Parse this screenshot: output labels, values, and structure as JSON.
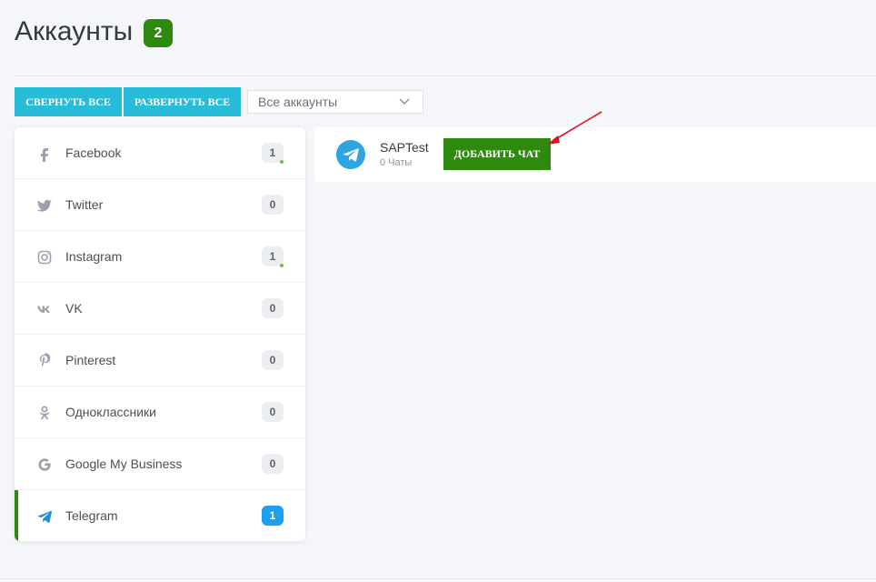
{
  "header": {
    "title": "Аккаунты",
    "count": "2"
  },
  "toolbar": {
    "collapse_all_label": "СВЕРНУТЬ ВСЕ",
    "expand_all_label": "РАЗВЕРНУТЬ ВСЕ",
    "filter_value": "Все аккаунты"
  },
  "sidebar": {
    "items": [
      {
        "label": "Facebook",
        "count": "1",
        "icon": "facebook-icon",
        "online": true
      },
      {
        "label": "Twitter",
        "count": "0",
        "icon": "twitter-icon"
      },
      {
        "label": "Instagram",
        "count": "1",
        "icon": "instagram-icon",
        "online": true
      },
      {
        "label": "VK",
        "count": "0",
        "icon": "vk-icon"
      },
      {
        "label": "Pinterest",
        "count": "0",
        "icon": "pinterest-icon"
      },
      {
        "label": "Одноклассники",
        "count": "0",
        "icon": "odnoklassniki-icon"
      },
      {
        "label": "Google My Business",
        "count": "0",
        "icon": "google-icon"
      },
      {
        "label": "Telegram",
        "count": "1",
        "icon": "telegram-icon",
        "active": true
      }
    ]
  },
  "account": {
    "name": "SAPTest",
    "subtitle": "0 Чаты",
    "add_chat_label": "ДОБАВИТЬ ЧАТ"
  },
  "colors": {
    "accent_green": "#2e8a0e",
    "teal": "#27bcd8",
    "telegram_blue": "#2ca5e0",
    "active_badge": "#1c9ff0",
    "annotation_arrow": "#e0141e"
  }
}
